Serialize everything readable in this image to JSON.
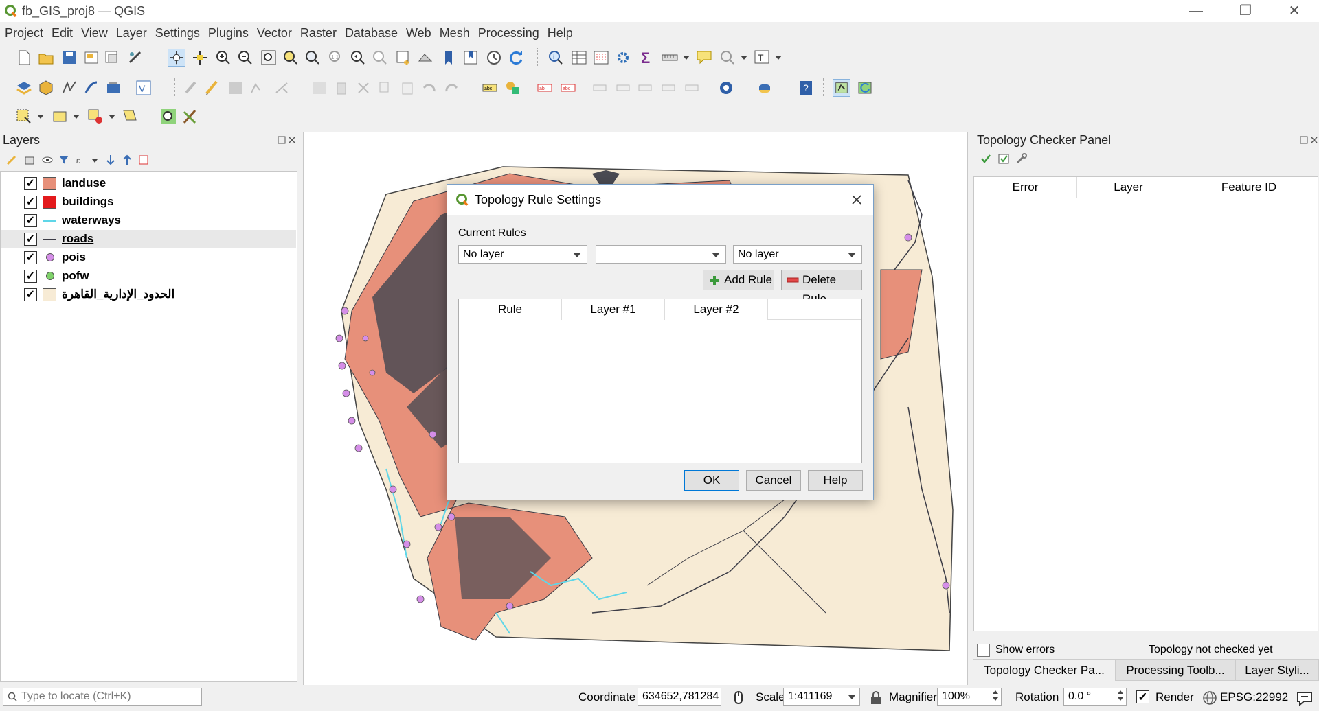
{
  "window": {
    "title": "fb_GIS_proj8 — QGIS",
    "minimize": "—",
    "restore": "❐",
    "close": "✕"
  },
  "menu": [
    "Project",
    "Edit",
    "View",
    "Layer",
    "Settings",
    "Plugins",
    "Vector",
    "Raster",
    "Database",
    "Web",
    "Mesh",
    "Processing",
    "Help"
  ],
  "layers_panel": {
    "title": "Layers",
    "layers": [
      {
        "name": "landuse",
        "checked": true,
        "symbol": "fill",
        "color": "#e7907a"
      },
      {
        "name": "buildings",
        "checked": true,
        "symbol": "fill",
        "color": "#e31a1c"
      },
      {
        "name": "waterways",
        "checked": true,
        "symbol": "line",
        "color": "#5fd6e8"
      },
      {
        "name": "roads",
        "checked": true,
        "symbol": "line",
        "color": "#3c3c46"
      },
      {
        "name": "pois",
        "checked": true,
        "symbol": "point",
        "color": "#d58ee8"
      },
      {
        "name": "pofw",
        "checked": true,
        "symbol": "point",
        "color": "#7fd16a"
      },
      {
        "name": "الحدود_الإدارية_القاهرة",
        "checked": true,
        "symbol": "fill",
        "color": "#f7ebd5"
      }
    ]
  },
  "topology_panel": {
    "title": "Topology Checker Panel",
    "columns": [
      "Error",
      "Layer",
      "Feature ID"
    ],
    "show_errors_label": "Show errors",
    "status": "Topology not checked yet",
    "tabs": [
      "Topology Checker Pa...",
      "Processing Toolb...",
      "Layer Styli..."
    ]
  },
  "dialog": {
    "title": "Topology Rule Settings",
    "current_rules_label": "Current Rules",
    "layer1_value": "No layer",
    "rule_value": "",
    "layer2_value": "No layer",
    "add_rule": "Add Rule",
    "delete_rule": "Delete Rule",
    "columns": [
      "Rule",
      "Layer #1",
      "Layer #2"
    ],
    "ok": "OK",
    "cancel": "Cancel",
    "help": "Help"
  },
  "statusbar": {
    "locate_placeholder": "Type to locate (Ctrl+K)",
    "coordinate_label": "Coordinate",
    "coordinate_value": "634652,781284",
    "scale_label": "Scale",
    "scale_value": "1:411169",
    "magnifier_label": "Magnifier",
    "magnifier_value": "100%",
    "rotation_label": "Rotation",
    "rotation_value": "0.0 °",
    "render_label": "Render",
    "crs": "EPSG:22992"
  },
  "colors": {
    "accent": "#589632",
    "dialog_border": "#7aa0c8",
    "tab_active": "#f0f0f0"
  }
}
